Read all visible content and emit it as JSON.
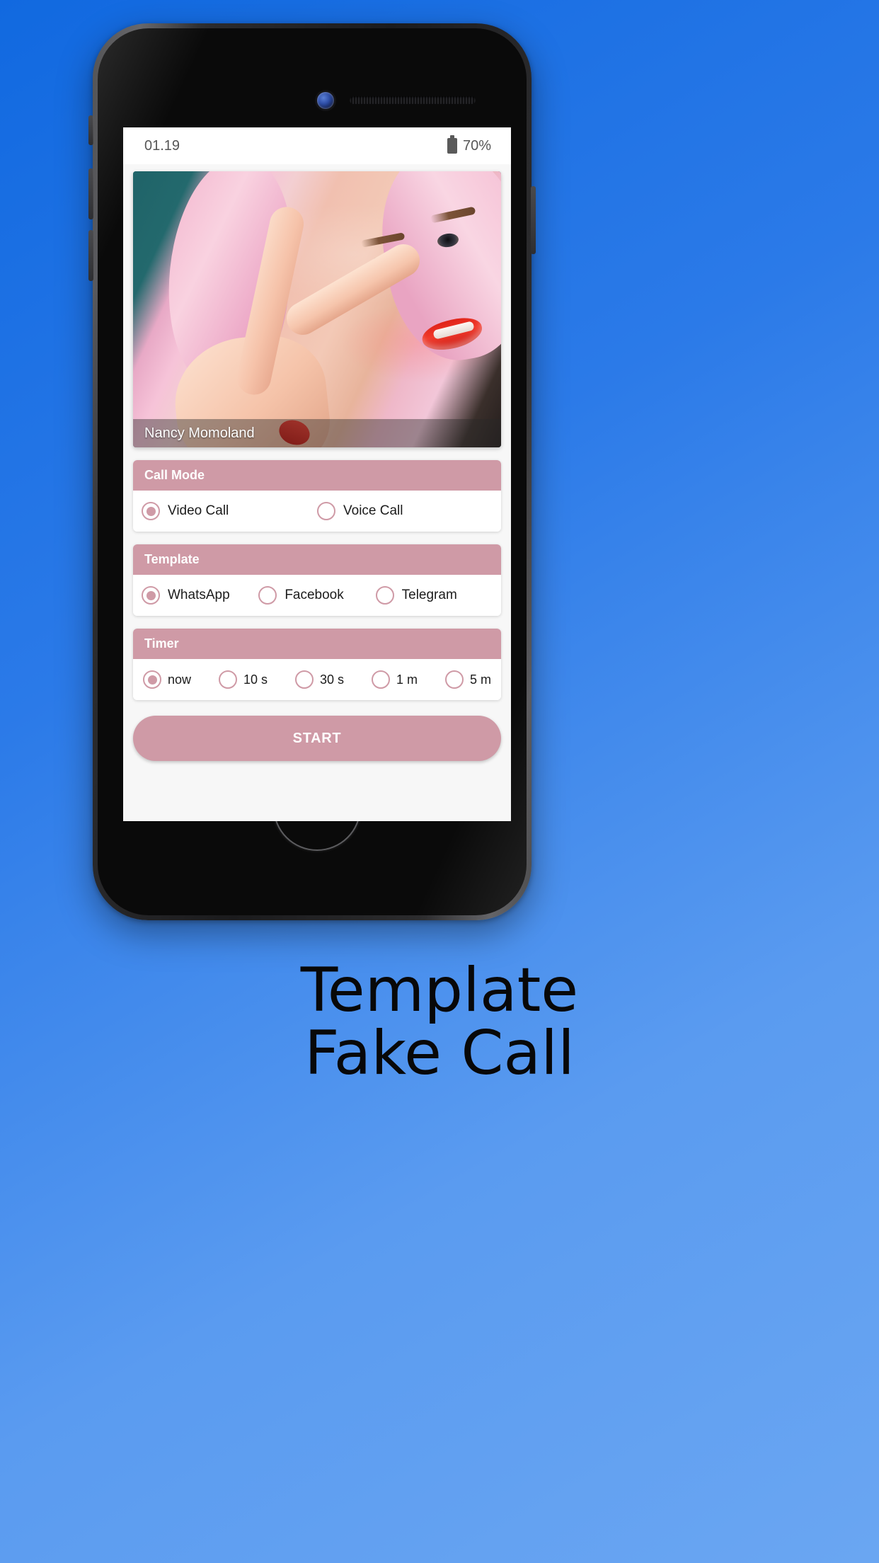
{
  "status_bar": {
    "time": "01.19",
    "battery_percent": "70%",
    "battery_icon": "battery-icon"
  },
  "contact": {
    "name": "Nancy Momoland"
  },
  "sections": [
    {
      "id": "call-mode",
      "title": "Call Mode",
      "options": [
        {
          "label": "Video Call",
          "selected": true
        },
        {
          "label": "Voice Call",
          "selected": false
        }
      ]
    },
    {
      "id": "template",
      "title": "Template",
      "options": [
        {
          "label": "WhatsApp",
          "selected": true
        },
        {
          "label": "Facebook",
          "selected": false
        },
        {
          "label": "Telegram",
          "selected": false
        }
      ]
    },
    {
      "id": "timer",
      "title": "Timer",
      "options": [
        {
          "label": "now",
          "selected": true
        },
        {
          "label": "10 s",
          "selected": false
        },
        {
          "label": "30 s",
          "selected": false
        },
        {
          "label": "1 m",
          "selected": false
        },
        {
          "label": "5 m",
          "selected": false
        }
      ]
    }
  ],
  "call_mode": {
    "title": "Call Mode",
    "option_0": "Video Call",
    "option_1": "Voice Call"
  },
  "template": {
    "title": "Template",
    "option_0": "WhatsApp",
    "option_1": "Facebook",
    "option_2": "Telegram"
  },
  "timer": {
    "title": "Timer",
    "option_0": "now",
    "option_1": "10 s",
    "option_2": "30 s",
    "option_3": "1 m",
    "option_4": "5 m"
  },
  "start_button": {
    "label": "START"
  },
  "caption": {
    "line1": "Template",
    "line2": "Fake Call"
  },
  "colors": {
    "accent_pink": "#cf9aa6",
    "background_blue_start": "#1169e0",
    "background_blue_end": "#6aa6f2",
    "screen_background": "#f7f7f7",
    "card_white": "#ffffff"
  }
}
